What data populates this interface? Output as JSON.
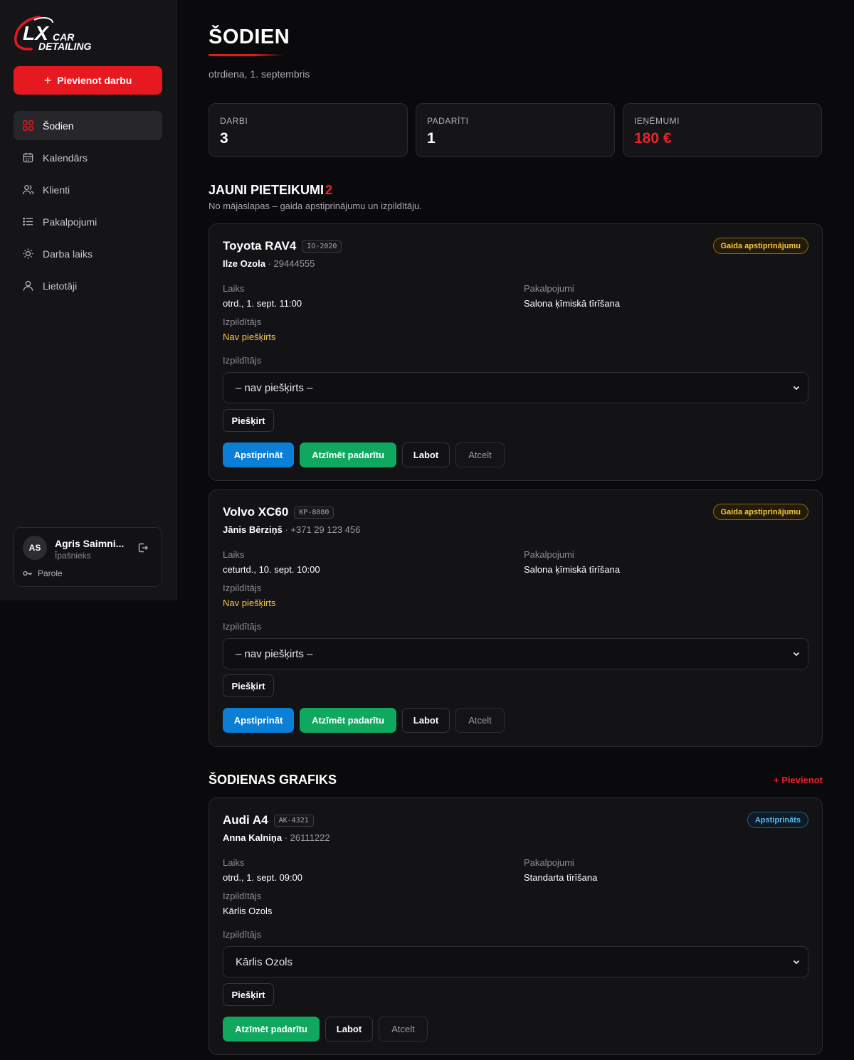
{
  "brand": {
    "logo_text_1": "CAR",
    "logo_text_2": "DETAILING",
    "accent": "#e5191f"
  },
  "sidebar": {
    "add_button": "Pievienot darbu",
    "items": [
      {
        "label": "Šodien",
        "icon": "grid-icon",
        "active": true
      },
      {
        "label": "Kalendārs",
        "icon": "calendar-icon"
      },
      {
        "label": "Klienti",
        "icon": "users-icon"
      },
      {
        "label": "Pakalpojumi",
        "icon": "list-icon"
      },
      {
        "label": "Darba laiks",
        "icon": "sun-icon"
      },
      {
        "label": "Lietotāji",
        "icon": "user-icon"
      }
    ],
    "user": {
      "initials": "AS",
      "name": "Agris Saimni...",
      "role": "Īpašnieks",
      "password_label": "Parole"
    }
  },
  "header": {
    "title": "ŠODIEN",
    "date": "otrdiena, 1. septembris"
  },
  "stats": [
    {
      "label": "DARBI",
      "value": "3"
    },
    {
      "label": "PADARĪTI",
      "value": "1"
    },
    {
      "label": "IEŅĒMUMI",
      "value": "180 €"
    }
  ],
  "new_requests": {
    "title": "JAUNI PIETEIKUMI",
    "count": "2",
    "subtitle": "No mājaslapas – gaida apstiprinājumu un izpildītāju."
  },
  "schedule": {
    "title": "ŠODIENAS GRAFIKS",
    "add_link": "+ Pievienot"
  },
  "labels": {
    "time": "Laiks",
    "services": "Pakalpojumi",
    "performer": "Izpildītājs",
    "assign": "Piešķirt",
    "confirm": "Apstiprināt",
    "mark_done": "Atzīmēt padarītu",
    "edit": "Labot",
    "cancel": "Atcelt"
  },
  "cards": [
    {
      "car": "Toyota RAV4",
      "plate": "IO-2020",
      "status": "Gaida apstiprinājumu",
      "client": "Ilze Ozola",
      "phone": "29444555",
      "time": "otrd., 1. sept. 11:00",
      "services": "Salona ķīmiskā tīrīšana",
      "performer": "Nav piešķirts",
      "select": "– nav piešķirts –"
    },
    {
      "car": "Volvo XC60",
      "plate": "KP-8080",
      "status": "Gaida apstiprinājumu",
      "client": "Jānis Bērziņš",
      "phone": "+371 29 123 456",
      "time": "ceturtd., 10. sept. 10:00",
      "services": "Salona ķīmiskā tīrīšana",
      "performer": "Nav piešķirts",
      "select": "– nav piešķirts –"
    },
    {
      "car": "Audi A4",
      "plate": "AK-4321",
      "status": "Apstiprināts",
      "client": "Anna Kalniņa",
      "phone": "26111222",
      "time": "otrd., 1. sept. 09:00",
      "services": "Standarta tīrīšana",
      "performer": "Kārlis Ozols",
      "select": "Kārlis Ozols"
    }
  ]
}
